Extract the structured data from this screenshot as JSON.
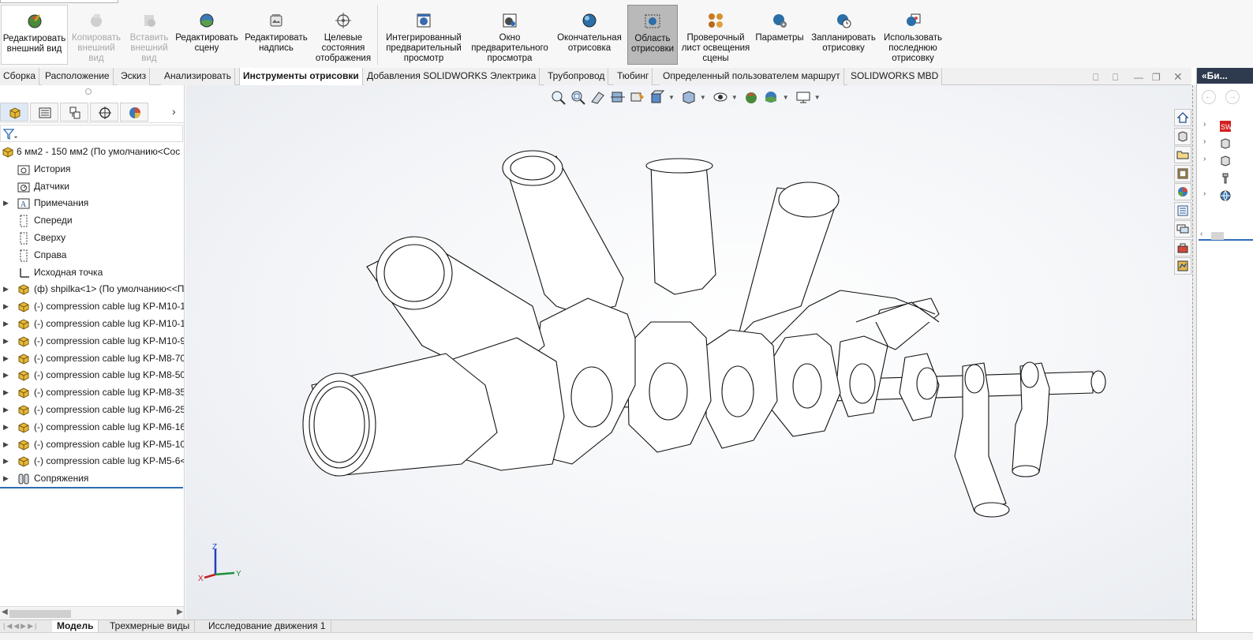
{
  "ribbon": {
    "buttons": [
      {
        "label": "Редактировать внешний вид",
        "state": "normal"
      },
      {
        "label": "Копировать внешний вид",
        "state": "disabled"
      },
      {
        "label": "Вставить внешний вид",
        "state": "disabled"
      },
      {
        "label": "Редактировать сцену",
        "state": "normal"
      },
      {
        "label": "Редактировать надпись",
        "state": "normal"
      },
      {
        "label": "Целевые состояния отображения",
        "state": "normal"
      },
      {
        "label": "Интегрированный предварительный просмотр",
        "state": "normal"
      },
      {
        "label": "Окно предварительного просмотра",
        "state": "normal"
      },
      {
        "label": "Окончательная отрисовка",
        "state": "normal"
      },
      {
        "label": "Область отрисовки",
        "state": "active"
      },
      {
        "label": "Проверочный лист освещения сцены",
        "state": "normal"
      },
      {
        "label": "Параметры",
        "state": "normal"
      },
      {
        "label": "Запланировать отрисовку",
        "state": "normal"
      },
      {
        "label": "Использовать последнюю отрисовку",
        "state": "normal"
      }
    ]
  },
  "tabs": [
    "Сборка",
    "Расположение",
    "Эскиз",
    "Анализировать",
    "Инструменты отрисовки",
    "Добавления SOLIDWORKS",
    "Электрика",
    "Трубопровод",
    "Тюбинг",
    "Определенный пользователем маршрут",
    "SOLIDWORKS MBD"
  ],
  "active_tab": "Инструменты отрисовки",
  "feature_tree": {
    "root": "6 мм2 - 150 мм2  (По умолчанию<Сос",
    "items": [
      {
        "label": "История",
        "icon": "history-folder-icon",
        "expandable": false
      },
      {
        "label": "Датчики",
        "icon": "sensors-icon",
        "expandable": false
      },
      {
        "label": "Примечания",
        "icon": "annotations-icon",
        "expandable": true
      },
      {
        "label": "Спереди",
        "icon": "plane-icon",
        "expandable": false
      },
      {
        "label": "Сверху",
        "icon": "plane-icon",
        "expandable": false
      },
      {
        "label": "Справа",
        "icon": "plane-icon",
        "expandable": false
      },
      {
        "label": "Исходная точка",
        "icon": "origin-icon",
        "expandable": false
      },
      {
        "label": "(ф) shpilka<1> (По умолчанию<<П",
        "icon": "part-icon",
        "expandable": true
      },
      {
        "label": "(-) compression cable lug KP-M10-1",
        "icon": "part-icon",
        "expandable": true
      },
      {
        "label": "(-) compression cable lug KP-M10-1",
        "icon": "part-icon",
        "expandable": true
      },
      {
        "label": "(-) compression cable lug KP-M10-9",
        "icon": "part-icon",
        "expandable": true
      },
      {
        "label": "(-) compression cable lug KP-M8-70",
        "icon": "part-icon",
        "expandable": true
      },
      {
        "label": "(-) compression cable lug KP-M8-50",
        "icon": "part-icon",
        "expandable": true
      },
      {
        "label": "(-) compression cable lug KP-M8-35",
        "icon": "part-icon",
        "expandable": true
      },
      {
        "label": "(-) compression cable lug KP-M6-25",
        "icon": "part-icon",
        "expandable": true
      },
      {
        "label": "(-) compression cable lug KP-M6-16",
        "icon": "part-icon",
        "expandable": true
      },
      {
        "label": "(-) compression cable lug KP-M5-10",
        "icon": "part-icon",
        "expandable": true
      },
      {
        "label": "(-) compression cable lug KP-M5-6<",
        "icon": "part-icon",
        "expandable": true
      },
      {
        "label": "Сопряжения",
        "icon": "mates-icon",
        "expandable": true
      }
    ]
  },
  "bottom_tabs": [
    "Модель",
    "Трехмерные виды",
    "Исследование движения 1"
  ],
  "active_bottom_tab": "Модель",
  "task_pane": {
    "title": "«Би..."
  },
  "triad": {
    "z": "Z",
    "y": "Y",
    "x": "X"
  },
  "colors": {
    "accent": "#2f6cb5",
    "ribbon_bg": "#f7f7f7",
    "active_button": "#b9b9b9",
    "task_pane_title": "#2e3a4d"
  }
}
